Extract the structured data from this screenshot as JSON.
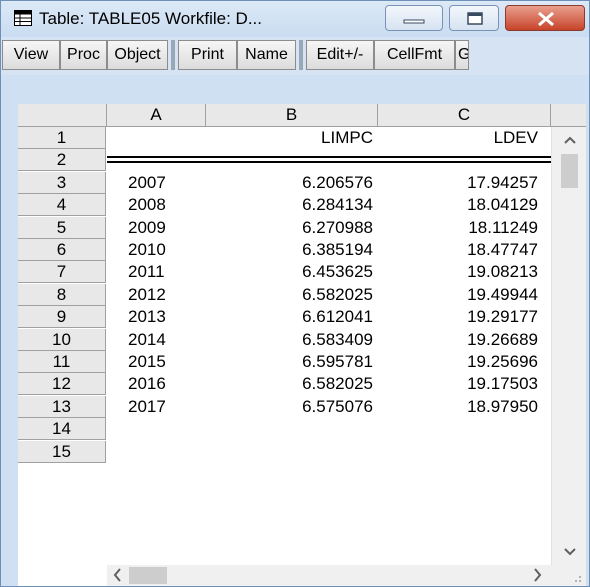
{
  "window": {
    "title": "Table: TABLE05   Workfile: D..."
  },
  "toolbar": {
    "buttons": [
      "View",
      "Proc",
      "Object",
      "Print",
      "Name",
      "Edit+/-",
      "CellFmt",
      "G"
    ]
  },
  "grid": {
    "columns": [
      "A",
      "B",
      "C"
    ],
    "row_numbers": [
      "1",
      "2",
      "3",
      "4",
      "5",
      "6",
      "7",
      "8",
      "9",
      "10",
      "11",
      "12",
      "13",
      "14",
      "15"
    ],
    "headers": {
      "B": "LIMPC",
      "C": "LDEV"
    },
    "rows": [
      {
        "A": "2007",
        "B": "6.206576",
        "C": "17.94257"
      },
      {
        "A": "2008",
        "B": "6.284134",
        "C": "18.04129"
      },
      {
        "A": "2009",
        "B": "6.270988",
        "C": "18.11249"
      },
      {
        "A": "2010",
        "B": "6.385194",
        "C": "18.47747"
      },
      {
        "A": "2011",
        "B": "6.453625",
        "C": "19.08213"
      },
      {
        "A": "2012",
        "B": "6.582025",
        "C": "19.49944"
      },
      {
        "A": "2013",
        "B": "6.612041",
        "C": "19.29177"
      },
      {
        "A": "2014",
        "B": "6.583409",
        "C": "19.26689"
      },
      {
        "A": "2015",
        "B": "6.595781",
        "C": "19.25696"
      },
      {
        "A": "2016",
        "B": "6.582025",
        "C": "19.17503"
      },
      {
        "A": "2017",
        "B": "6.575076",
        "C": "18.97950"
      }
    ]
  },
  "colors": {
    "titlebar": "#cfe0f3",
    "close_button": "#c7432a",
    "header_bg": "#e8e8e8"
  },
  "icons": {
    "app": "table-icon",
    "minimize": "minimize-icon",
    "maximize": "maximize-icon",
    "close": "close-icon"
  }
}
